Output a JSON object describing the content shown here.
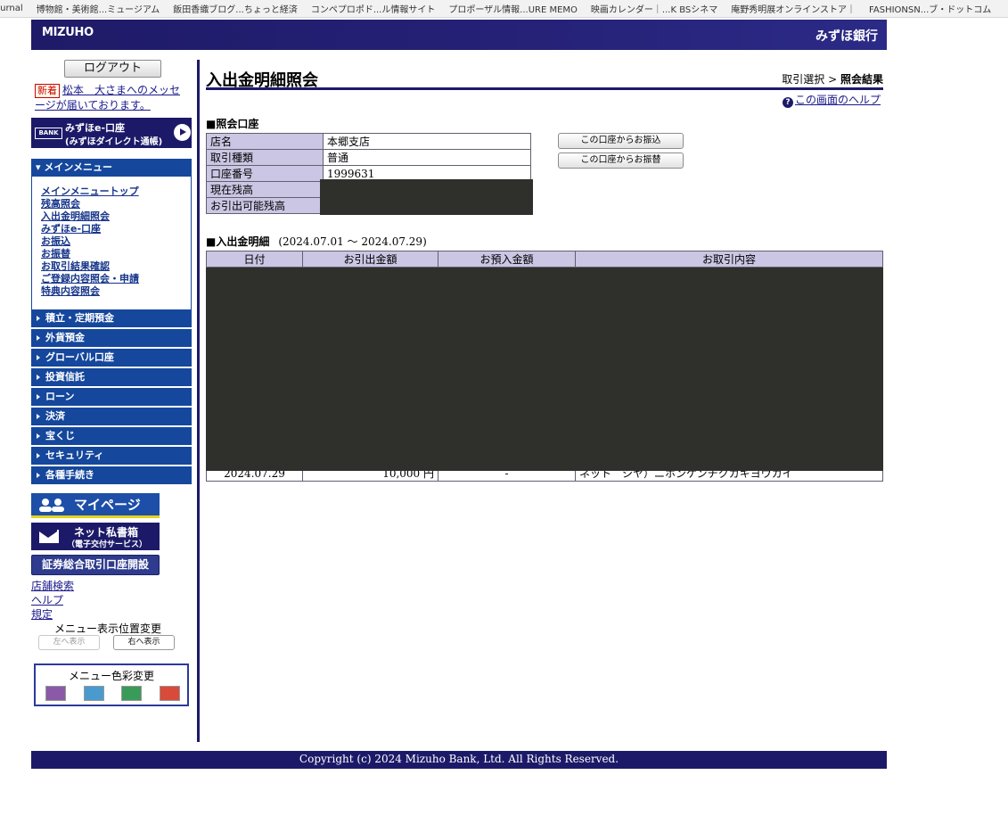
{
  "bookmarks": [
    "ournal",
    "博物館・美術館...ミュージアム",
    "飯田香織ブログ...ちょっと経済",
    "コンペプロポド...ル情報サイト",
    "プロポーザル情報...URE MEMO",
    "映画カレンダー｜...K BSシネマ",
    "庵野秀明展オンラインストア｜",
    "FASHIONSN...ブ・ドットコム"
  ],
  "header": {
    "logo": "MIZUHO",
    "bank_name": "みずほ銀行"
  },
  "sidebar": {
    "logout": "ログアウト",
    "new_badge": "新着",
    "notice": "松本　大さまへのメッセージが届いております。",
    "eaccount": {
      "icon": "BANK",
      "line1": "みずほe-口座",
      "line2": "(みずほダイレクト通帳)",
      "play_icon": "play-circle-icon"
    },
    "main_menu_title": "メインメニュー",
    "main_menu_items": [
      "メインメニュートップ",
      "残高照会",
      "入出金明細照会",
      "みずほe-口座",
      "お振込",
      "お振替",
      "お取引結果確認",
      "ご登録内容照会・申請",
      "特典内容照会"
    ],
    "categories": [
      "積立・定期預金",
      "外貨預金",
      "グローバル口座",
      "投資信託",
      "ローン",
      "決済",
      "宝くじ",
      "セキュリティ",
      "各種手続き"
    ],
    "mypage": "マイページ",
    "netbox": {
      "line1": "ネット私書箱",
      "line2": "（電子交付サービス）"
    },
    "securities": "証券総合取引口座開設",
    "links": [
      "店舗検索",
      "ヘルプ",
      "規定"
    ],
    "menu_position": {
      "label": "メニュー表示位置変更",
      "left": "左へ表示",
      "right": "右へ表示"
    },
    "menu_color": {
      "label": "メニュー色彩変更",
      "colors": [
        "#8a5aa8",
        "#4a9ad0",
        "#3a9a5a",
        "#d84a3a"
      ]
    }
  },
  "main": {
    "title": "入出金明細照会",
    "breadcrumb_step1": "取引選択",
    "breadcrumb_sep": ">",
    "breadcrumb_current": "照会結果",
    "help": "この画面のヘルプ",
    "account_section": "■照会口座",
    "account_rows": [
      {
        "label": "店名",
        "value": "本郷支店"
      },
      {
        "label": "取引種類",
        "value": "普通"
      },
      {
        "label": "口座番号",
        "value": "1999631"
      },
      {
        "label": "現在残高",
        "value": ""
      },
      {
        "label": "お引出可能残高",
        "value": ""
      }
    ],
    "btn_transfer": "この口座からお振込",
    "btn_move": "この口座からお振替",
    "tx_section": "■入出金明細",
    "tx_period": "(2024.07.01 〜 2024.07.29)",
    "tx_headers": [
      "日付",
      "お引出金額",
      "お預入金額",
      "お取引内容"
    ],
    "tx_last_row": {
      "date": "2024.07.29",
      "withdrawal": "10,000 円",
      "deposit": "-",
      "description": "ネット　シヤ）ニホンケンチクカキヨウカイ"
    }
  },
  "footer": "Copyright (c) 2024 Mizuho Bank, Ltd. All Rights Reserved."
}
